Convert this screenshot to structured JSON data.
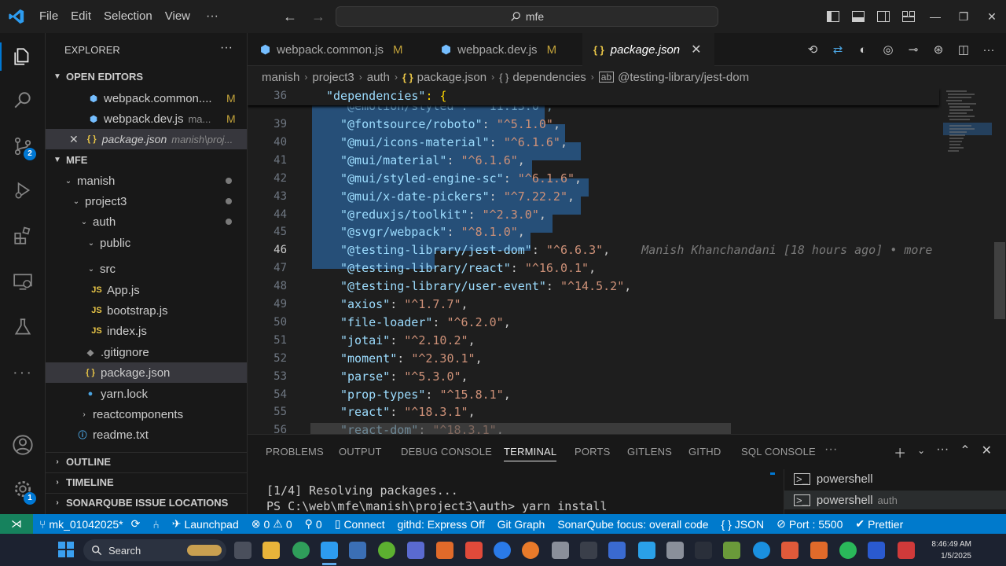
{
  "titlebar": {
    "menus": [
      "File",
      "Edit",
      "Selection",
      "View"
    ],
    "more": "···",
    "search_text": "mfe"
  },
  "activity": {
    "source_control_badge": "2",
    "accounts_badge": "1"
  },
  "sidebar": {
    "title": "EXPLORER",
    "more": "···",
    "open_editors": {
      "header": "OPEN EDITORS",
      "items": [
        {
          "name": "webpack.common....",
          "status": "M"
        },
        {
          "name": "webpack.dev.js",
          "path": "ma...",
          "status": "M"
        },
        {
          "name": "package.json",
          "path": "manish\\proj..."
        }
      ]
    },
    "workspace": {
      "header": "MFE",
      "items": [
        {
          "label": "manish"
        },
        {
          "label": "project3"
        },
        {
          "label": "auth"
        },
        {
          "label": "public"
        },
        {
          "label": "src"
        },
        {
          "label": "App.js",
          "icon": "JS"
        },
        {
          "label": "bootstrap.js",
          "icon": "JS"
        },
        {
          "label": "index.js",
          "icon": "JS"
        },
        {
          "label": ".gitignore"
        },
        {
          "label": "package.json",
          "icon": "{ }"
        },
        {
          "label": "yarn.lock"
        },
        {
          "label": "reactcomponents"
        },
        {
          "label": "readme.txt"
        }
      ]
    },
    "outline": "OUTLINE",
    "timeline": "TIMELINE",
    "sonarqube": "SONARQUBE ISSUE LOCATIONS"
  },
  "tabs": [
    {
      "label": "webpack.common.js",
      "status": "M"
    },
    {
      "label": "webpack.dev.js",
      "status": "M"
    },
    {
      "label": "package.json"
    }
  ],
  "breadcrumb": [
    "manish",
    "project3",
    "auth",
    "package.json",
    "dependencies",
    "@testing-library/jest-dom"
  ],
  "editor": {
    "sticky": {
      "num": "36",
      "key": "\"dependencies\"",
      "rest": ": {"
    },
    "partial_line": "\"@emotion/styled\": \"^11.13.0\",",
    "lines": [
      {
        "num": "39",
        "key": "\"@fontsource/roboto\"",
        "val": "\"^5.1.0\""
      },
      {
        "num": "40",
        "key": "\"@mui/icons-material\"",
        "val": "\"^6.1.6\""
      },
      {
        "num": "41",
        "key": "\"@mui/material\"",
        "val": "\"^6.1.6\""
      },
      {
        "num": "42",
        "key": "\"@mui/styled-engine-sc\"",
        "val": "\"^6.1.6\""
      },
      {
        "num": "43",
        "key": "\"@mui/x-date-pickers\"",
        "val": "\"^7.22.2\""
      },
      {
        "num": "44",
        "key": "\"@reduxjs/toolkit\"",
        "val": "\"^2.3.0\""
      },
      {
        "num": "45",
        "key": "\"@svgr/webpack\"",
        "val": "\"^8.1.0\""
      },
      {
        "num": "46",
        "key": "\"@testing-library/jest-dom\"",
        "val": "\"^6.6.3\""
      },
      {
        "num": "47",
        "key": "\"@testing-library/react\"",
        "val": "\"^16.0.1\""
      },
      {
        "num": "48",
        "key": "\"@testing-library/user-event\"",
        "val": "\"^14.5.2\""
      },
      {
        "num": "49",
        "key": "\"axios\"",
        "val": "\"^1.7.7\""
      },
      {
        "num": "50",
        "key": "\"file-loader\"",
        "val": "\"^6.2.0\""
      },
      {
        "num": "51",
        "key": "\"jotai\"",
        "val": "\"^2.10.2\""
      },
      {
        "num": "52",
        "key": "\"moment\"",
        "val": "\"^2.30.1\""
      },
      {
        "num": "53",
        "key": "\"parse\"",
        "val": "\"^5.3.0\""
      },
      {
        "num": "54",
        "key": "\"prop-types\"",
        "val": "\"^15.8.1\""
      },
      {
        "num": "55",
        "key": "\"react\"",
        "val": "\"^18.3.1\""
      },
      {
        "num": "56",
        "key": "\"react-dom\"",
        "val": "\"^18.3.1\""
      }
    ],
    "blame": "Manish Khanchandani [18 hours ago] • more"
  },
  "panel": {
    "tabs": [
      "PROBLEMS",
      "OUTPUT",
      "DEBUG CONSOLE",
      "TERMINAL",
      "PORTS",
      "GITLENS",
      "GITHD",
      "SQL CONSOLE"
    ],
    "active_tab": "TERMINAL",
    "more": "···",
    "terminal_lines": [
      "[1/4] Resolving packages...",
      "PS C:\\web\\mfe\\manish\\project3\\auth> yarn install"
    ],
    "terminals": [
      {
        "name": "powershell",
        "detail": ""
      },
      {
        "name": "powershell",
        "detail": "auth"
      }
    ]
  },
  "statusbar": {
    "branch": "mk_01042025*",
    "launchpad": "Launchpad",
    "errors": "0",
    "warnings": "0",
    "ports": "0",
    "connect": "Connect",
    "githd": "githd: Express Off",
    "gitgraph": "Git Graph",
    "sonar": "SonarQube focus: overall code",
    "language": "JSON",
    "port": "Port : 5500",
    "prettier": "Prettier"
  },
  "taskbar": {
    "search": "Search",
    "time": "8:46:49 AM",
    "date": "1/5/2025"
  },
  "colors": {
    "accent": "#007acc",
    "selection": "#264f78",
    "json_key": "#9cdcfe",
    "json_string": "#ce9178",
    "modified": "#c2a23a"
  }
}
